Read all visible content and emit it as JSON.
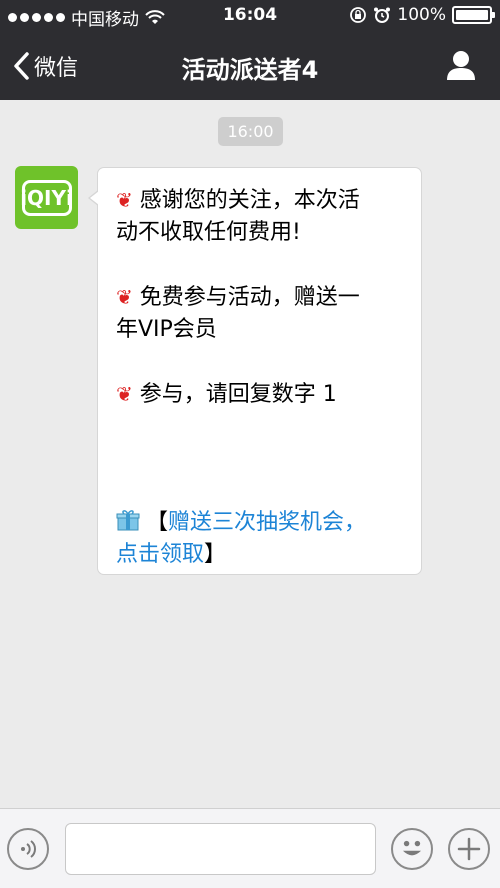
{
  "status_bar": {
    "carrier": "中国移动",
    "time": "16:04",
    "battery": "100%"
  },
  "nav": {
    "back_label": "微信",
    "title": "活动派送者4"
  },
  "chat": {
    "timestamp": "16:00",
    "avatar_logo": "iQIYi",
    "message": {
      "line1": "感谢您的关注，本次活",
      "line2": "动不收取任何费用!",
      "line3": "免费参与活动，赠送一",
      "line4": "年VIP会员",
      "line5": "参与，请回复数字 1",
      "link_open": "【",
      "link_line1": "赠送三次抽奖机会，",
      "link_line2": "点击领取",
      "link_close": "】"
    }
  },
  "input": {
    "value": ""
  },
  "icons": {
    "back": "chevron-left-icon",
    "profile": "person-icon",
    "rose": "rose-icon",
    "gift": "gift-icon",
    "voice": "voice-icon",
    "emoji": "smiley-icon",
    "plus": "plus-icon",
    "wifi": "wifi-icon",
    "lock": "rotation-lock-icon",
    "alarm": "alarm-icon",
    "battery": "battery-icon"
  },
  "colors": {
    "nav_bg": "#2d2d31",
    "chat_bg": "#ebebeb",
    "link": "#1d84d6",
    "avatar_green": "#6fc22a"
  }
}
